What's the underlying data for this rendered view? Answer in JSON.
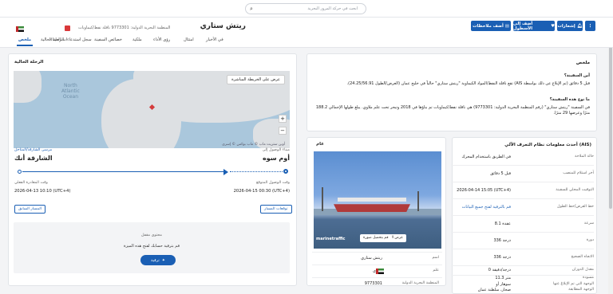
{
  "search": {
    "placeholder": "ابحث في حركة المرور البحرية"
  },
  "vessel": {
    "name": "ريتش ستاري",
    "subtitle": "المنظمة البحرية الدولية: 9773301 ناقلة نفط/كيماويات"
  },
  "actions": {
    "notifications": "إشعارات",
    "add_fleet": "أضف إلى الأسطول",
    "add_notes": "أضف ملاحظات",
    "more": "⋮"
  },
  "tabs": [
    "ملخص",
    "الرحلة الحالية",
    "سجل استدعاءات الميناء",
    "خصائص السفينة",
    "ملكية",
    "رؤى الأداء",
    "امتثال",
    "في الأخبار"
  ],
  "voyage": {
    "title": "الرحلة الحالية",
    "map_button": "عرض على الخريطة المباشرة",
    "map_labels": {
      "north": "North",
      "atlantic": "Atlantic",
      "ocean": "Ocean",
      "attribution": "أوبن ستريت ماب © ماب بوكس © إسري"
    },
    "departure_label": "ميناء الوصول إلى",
    "departure_port": "أوم سوه",
    "arrival_label": "مرسى الشارقة/المتاحل",
    "arrival_port": "الشارقة أنك",
    "atd_label": "وقت الوصول المتوقع",
    "atd_value": "2026-04-15 00:30 (UTC+4)",
    "eta_label": "وقت المغادرة الفعلي",
    "eta_value": "2026-04-13 10:10 (UTC+4)",
    "forecast_button": "توقعات المسار",
    "previous_button": "المسار السابق",
    "locked_label": "محتوى مقفل",
    "locked_text": "قم بترقية حسابك لفتح هذه الميزة",
    "upgrade_button": "ترقية"
  },
  "summary": {
    "title": "ملخص",
    "q1": "أين السفينة؟",
    "a1": "قبل 5 دقائق (تم الإبلاغ عن ذلك بواسطة AIS) تقع ناقلة النفط/المواد الكيماوية \"ريتش ستاري\" حالياً في خليج عمان (العرض/الطول 24.25/56.91).",
    "q2": "ما نوع هذه السفينة؟",
    "a2": "في السفينة \"ريتش ستاري\" (رقم المنظمة البحرية الدولية: 9773301) هي ناقلة نفط/كيماويات تم بناؤها في 2018 وتبحر تحت علم ملاوي. يبلغ طولها الإجمالي 188.2 مترًا وعرضها 29 مترًا."
  },
  "general": {
    "title": "عام",
    "photo_credit": "marinetraffic",
    "photo_btn_all": "عرض الكل (6)",
    "photo_btn_upload": "قم بتحميل صورة",
    "rows": [
      {
        "k": "اسم",
        "v": "ريتش ستاري"
      },
      {
        "k": "علم",
        "v": "ملاوي"
      },
      {
        "k": "المنظمة البحرية الدولية",
        "v": "9773301"
      }
    ]
  },
  "ais": {
    "title": "أحدث معلومات نظام التعرف الآلي (AIS)",
    "rows": [
      {
        "k": "حالة الملاحة",
        "v": "في الطريق باستخدام المحرك"
      },
      {
        "k": "آخر استلام للمنصب",
        "v": "قبل 5 دقائق"
      },
      {
        "k": "التوقيت المحلي للسفينة",
        "v": "2026-04-14 15:05 (UTC+4)"
      },
      {
        "k": "خط العرض/خط الطول",
        "v": "قم بالترقية لفتح جميع البيانات"
      },
      {
        "k": "سرعة",
        "v": "8.1 عقدة"
      },
      {
        "k": "دورة",
        "v": "336 درجة"
      },
      {
        "k": "الاتجاه الصحيح",
        "v": "336 درجة"
      },
      {
        "k": "معدل الدوران",
        "v": "0 درجة/دقيقة"
      },
      {
        "k": "مسودة",
        "v": "11.3 متر"
      },
      {
        "k": "الوجهة التي تم الإبلاغ عنها",
        "v": "سوهار أو"
      },
      {
        "k": "الوجهة المطابقة",
        "v": "صحار، سلطنة عمان"
      }
    ]
  }
}
